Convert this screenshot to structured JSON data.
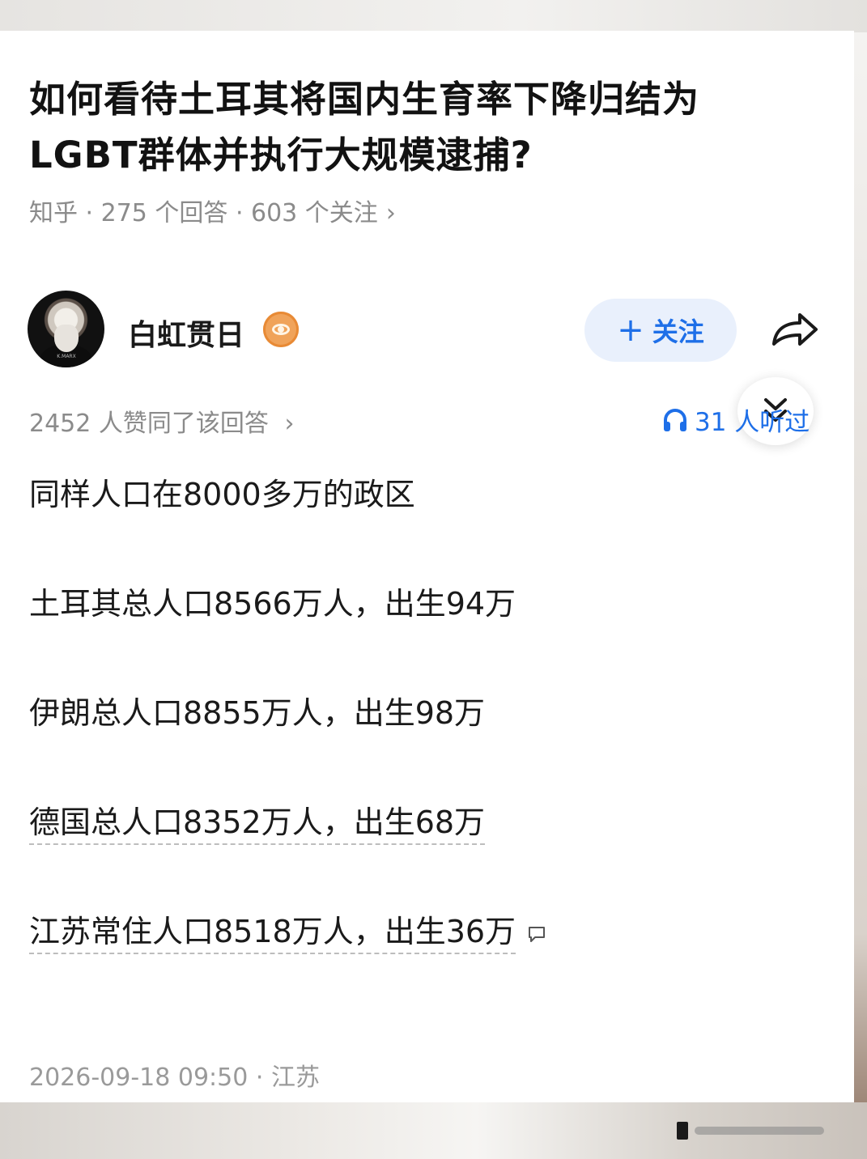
{
  "question": {
    "title": "如何看待土耳其将国内生育率下降归结为LGBT群体并执行大规模逮捕?",
    "meta": "知乎 · 275 个回答 · 603 个关注",
    "meta_chevron": "›"
  },
  "author": {
    "name": "白虹贯日",
    "avatar_caption": "K.MARX",
    "follow_label": "关注",
    "follow_icon": "+"
  },
  "answer": {
    "likes": "2452 人赞同了该回答",
    "likes_chevron": "›",
    "listen": "31 人听过",
    "paragraphs": [
      "同样人口在8000多万的政区",
      "土耳其总人口8566万人，出生94万",
      "伊朗总人口8855万人，出生98万",
      "德国总人口8352万人，出生68万",
      "江苏常住人口8518万人，出生36万"
    ],
    "timestamp": "2026-09-18 09:50 · 江苏"
  },
  "colors": {
    "accent": "#1e6fe8",
    "follow_bg": "#e9f0fc",
    "muted_text": "#8b8b8b",
    "badge": "#f0a35a"
  },
  "icons": [
    "share-icon",
    "expand-down-icon",
    "headphones-icon",
    "comment-icon",
    "verified-badge-icon"
  ]
}
